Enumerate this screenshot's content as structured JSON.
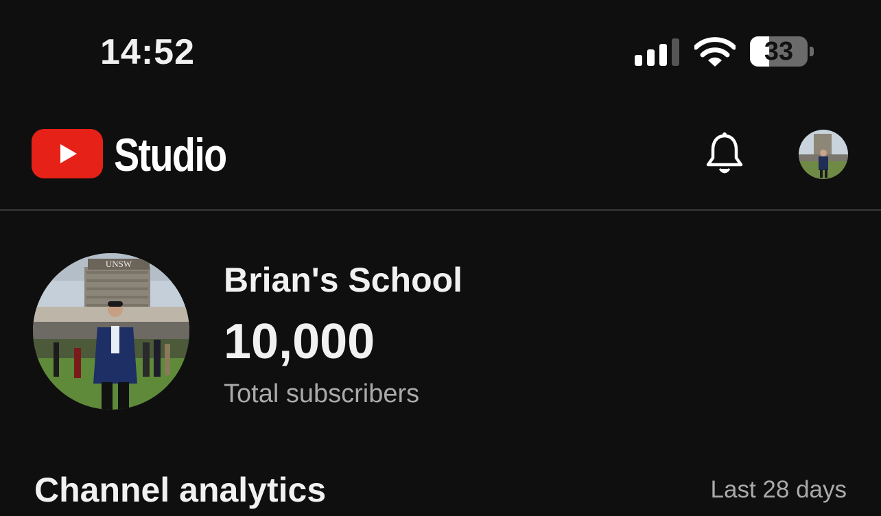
{
  "status_bar": {
    "time": "14:52",
    "battery_percent": "33",
    "battery_level": 0.33,
    "signal_bars_active": 3,
    "icons": [
      "signal-icon",
      "wifi-icon",
      "battery-icon"
    ]
  },
  "app_bar": {
    "logo_text": "Studio",
    "icons": [
      "youtube-logo-icon",
      "bell-icon",
      "account-avatar"
    ],
    "brand_color": "#ff0000"
  },
  "channel": {
    "name": "Brian's School",
    "subscriber_count": "10,000",
    "subscriber_label": "Total subscribers"
  },
  "analytics": {
    "title": "Channel analytics",
    "range": "Last 28 days"
  }
}
